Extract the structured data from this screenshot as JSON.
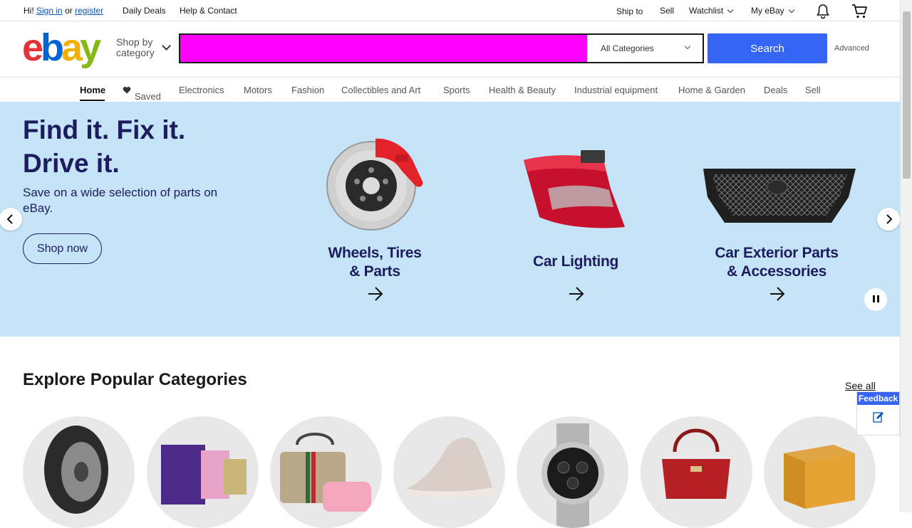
{
  "topbar": {
    "greeting": "Hi!",
    "sign_in": "Sign in",
    "or": "or",
    "register": "register",
    "daily_deals": "Daily Deals",
    "help": "Help & Contact",
    "ship_to": "Ship to",
    "sell": "Sell",
    "watchlist": "Watchlist",
    "my_ebay": "My eBay"
  },
  "header": {
    "shop_by_1": "Shop by",
    "shop_by_2": "category",
    "search_placeholder": "",
    "category_selected": "All Categories",
    "search_button": "Search",
    "advanced": "Advanced"
  },
  "nav": {
    "items": [
      "Home",
      "Saved",
      "Electronics",
      "Motors",
      "Fashion",
      "Collectibles and Art",
      "Sports",
      "Health & Beauty",
      "Industrial equipment",
      "Home & Garden",
      "Deals",
      "Sell"
    ]
  },
  "hero": {
    "title_line1": "Find it. Fix it.",
    "title_line2": "Drive it.",
    "subtitle": "Save on a wide selection of parts on eBay.",
    "cta": "Shop now",
    "tiles": [
      {
        "line1": "Wheels, Tires",
        "line2": "& Parts"
      },
      {
        "line1": "Car Lighting",
        "line2": ""
      },
      {
        "line1": "Car Exterior Parts",
        "line2": "& Accessories"
      }
    ]
  },
  "explore": {
    "title": "Explore Popular Categories",
    "see_all": "See all"
  },
  "feedback": {
    "label": "Feedback"
  },
  "colors": {
    "brand_blue": "#3665f3",
    "hero_bg": "#c5e4f7",
    "hero_text": "#1c1c5e",
    "search_field": "#ff00ff"
  }
}
